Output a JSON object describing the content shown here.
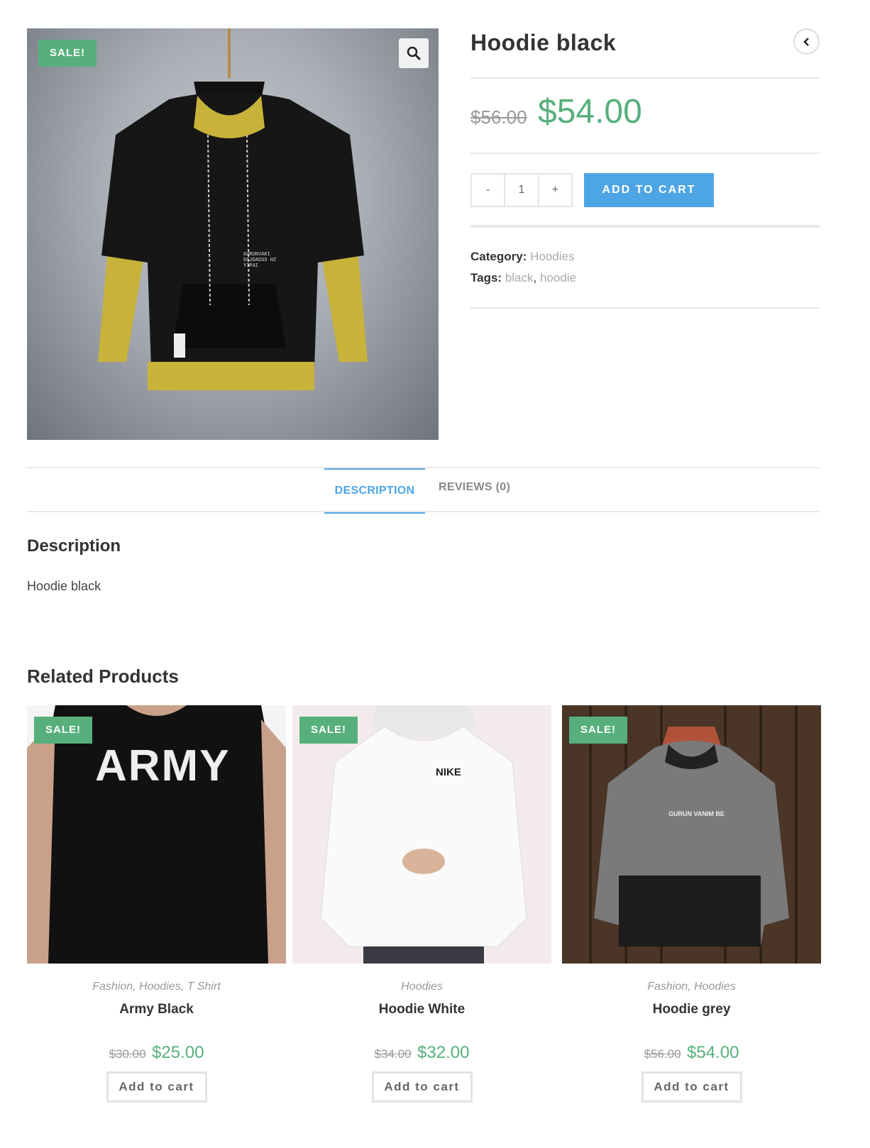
{
  "product": {
    "title": "Hoodie black",
    "sale_badge": "SALE!",
    "old_price": "$56.00",
    "new_price": "$54.00",
    "quantity": "1",
    "qty_minus": "-",
    "qty_plus": "+",
    "add_to_cart": "ADD TO CART",
    "category_label": "Category:",
    "category": "Hoodies",
    "tags_label": "Tags:",
    "tags": [
      "black",
      "hoodie"
    ],
    "image_print": "GURUNVAKI DSJDADSS HZ YIPAI"
  },
  "tabs": {
    "description": "DESCRIPTION",
    "reviews": "REVIEWS (0)"
  },
  "description": {
    "heading": "Description",
    "text": "Hoodie black"
  },
  "related": {
    "heading": "Related Products",
    "items": [
      {
        "sale": "SALE!",
        "categories": "Fashion, Hoodies, T Shirt",
        "name": "Army Black",
        "old_price": "$30.00",
        "new_price": "$25.00",
        "button": "Add to cart",
        "image_text": "ARMY"
      },
      {
        "sale": "SALE!",
        "categories": "Hoodies",
        "name": "Hoodie White",
        "old_price": "$34.00",
        "new_price": "$32.00",
        "button": "Add to cart",
        "image_text": "NIKE"
      },
      {
        "sale": "SALE!",
        "categories": "Fashion, Hoodies",
        "name": "Hoodie grey",
        "old_price": "$56.00",
        "new_price": "$54.00",
        "button": "Add to cart",
        "image_text": "GURUN VANIM BE"
      }
    ]
  },
  "colors": {
    "accent": "#4ea5e6",
    "sale": "#57b07c",
    "price": "#57b07c"
  },
  "icons": {
    "zoom": "search-icon",
    "back": "chevron-left-icon"
  }
}
